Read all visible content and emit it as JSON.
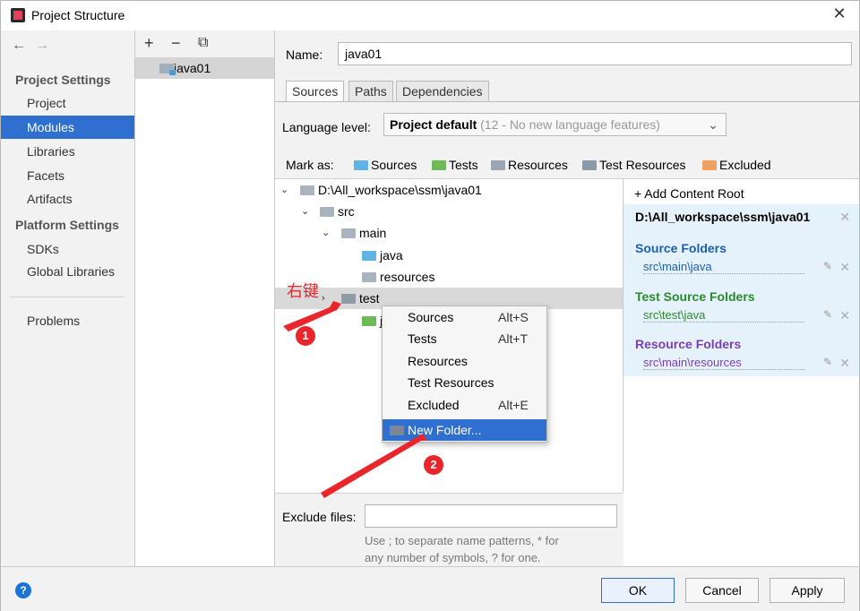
{
  "window": {
    "title": "Project Structure",
    "close_glyph": "✕"
  },
  "nav": {
    "back": "←",
    "forward": "→",
    "project_settings_header": "Project Settings",
    "platform_settings_header": "Platform Settings",
    "items": [
      "Project",
      "Modules",
      "Libraries",
      "Facets",
      "Artifacts"
    ],
    "platform_items": [
      "SDKs",
      "Global Libraries"
    ],
    "problems": "Problems"
  },
  "modules": {
    "add": "+",
    "remove": "−",
    "copy": "⧉",
    "items": [
      "java01"
    ]
  },
  "editor": {
    "name_label": "Name:",
    "name_value": "java01",
    "tabs": [
      "Sources",
      "Paths",
      "Dependencies"
    ],
    "language_label": "Language level:",
    "language_value_bold": "Project default",
    "language_value_dim": "(12 - No new language features)",
    "language_arrow": "⌄",
    "mark_as_label": "Mark as:",
    "mark_as": [
      {
        "label": "Sources",
        "color": "#5fb4e5"
      },
      {
        "label": "Tests",
        "color": "#6dbb57"
      },
      {
        "label": "Resources",
        "color": "#9aa6b2"
      },
      {
        "label": "Test Resources",
        "color": "#8a9aa6"
      },
      {
        "label": "Excluded",
        "color": "#f0a060"
      }
    ]
  },
  "tree": {
    "rows": [
      {
        "label": "D:\\All_workspace\\ssm\\java01",
        "chevron": "⌄"
      },
      {
        "label": "src",
        "chevron": "⌄"
      },
      {
        "label": "main",
        "chevron": "⌄"
      },
      {
        "label": "java"
      },
      {
        "label": "resources"
      },
      {
        "label": "test",
        "chevron": "›"
      },
      {
        "label": "j"
      }
    ],
    "folder_colors": {
      "plain": "#a9b4be",
      "source": "#5fb4e5",
      "test": "#6dbb57"
    }
  },
  "context_menu": {
    "items": [
      {
        "label": "Sources",
        "shortcut": "Alt+S"
      },
      {
        "label": "Tests",
        "shortcut": "Alt+T"
      },
      {
        "label": "Resources",
        "shortcut": ""
      },
      {
        "label": "Test Resources",
        "shortcut": ""
      },
      {
        "label": "Excluded",
        "shortcut": "Alt+E"
      },
      {
        "label": "New Folder...",
        "shortcut": ""
      }
    ]
  },
  "content_roots": {
    "add_label": "+ Add Content Root",
    "root_path": "D:\\All_workspace\\ssm\\java01",
    "source_header": "Source Folders",
    "source_path": "src\\main\\java",
    "test_header": "Test Source Folders",
    "test_path": "src\\test\\java",
    "resource_header": "Resource Folders",
    "resource_path": "src\\main\\resources",
    "colors": {
      "source": "#1b5fb0",
      "test": "#2a8a2a",
      "resource": "#7a3fb8"
    }
  },
  "exclude": {
    "label": "Exclude files:",
    "hint_line1": "Use ; to separate name patterns, * for",
    "hint_line2": "any number of symbols, ? for one."
  },
  "annotations": {
    "right_click": "右键",
    "step1": "1",
    "step2": "2"
  },
  "buttons": {
    "help": "?",
    "ok": "OK",
    "cancel": "Cancel",
    "apply": "Apply"
  }
}
